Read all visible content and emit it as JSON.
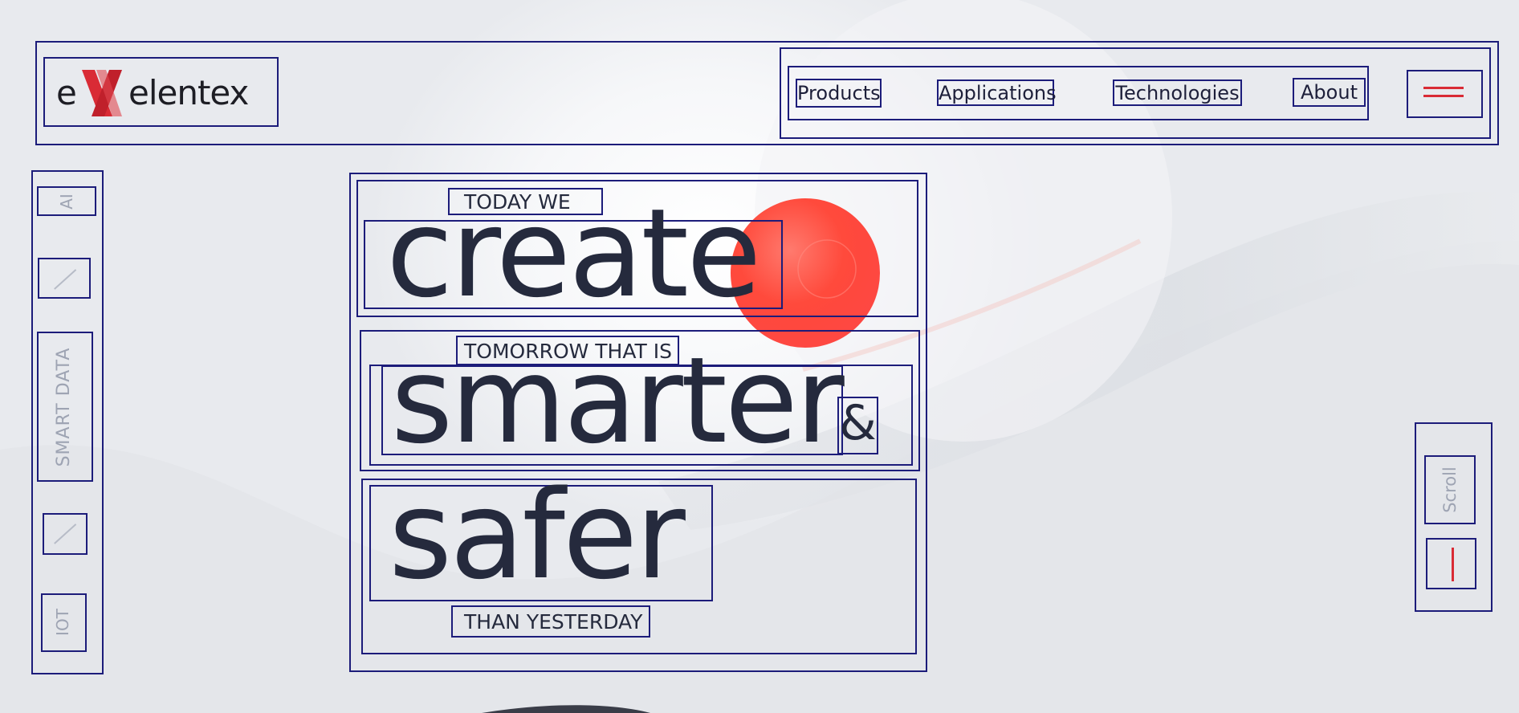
{
  "brand": {
    "logo_text": "eXelentex"
  },
  "nav": {
    "items": [
      {
        "label": "Products"
      },
      {
        "label": "Applications"
      },
      {
        "label": "Technologies"
      },
      {
        "label": "About"
      }
    ],
    "menu_icon": "hamburger-icon"
  },
  "sidebar": {
    "items": [
      {
        "label": "AI"
      },
      {
        "label": "SMART DATA"
      },
      {
        "label": "IOT"
      }
    ]
  },
  "hero": {
    "line1_small": "TODAY WE",
    "line1_big": "create",
    "line2_small": "TOMORROW THAT IS",
    "line2_big": "smarter",
    "ampersand": "&",
    "line3_big": "safer",
    "line3_small": "THAN YESTERDAY"
  },
  "scroll": {
    "label": "Scroll"
  },
  "colors": {
    "accent": "#d92b35",
    "text": "#252a3d",
    "muted": "#9ea4b3"
  }
}
